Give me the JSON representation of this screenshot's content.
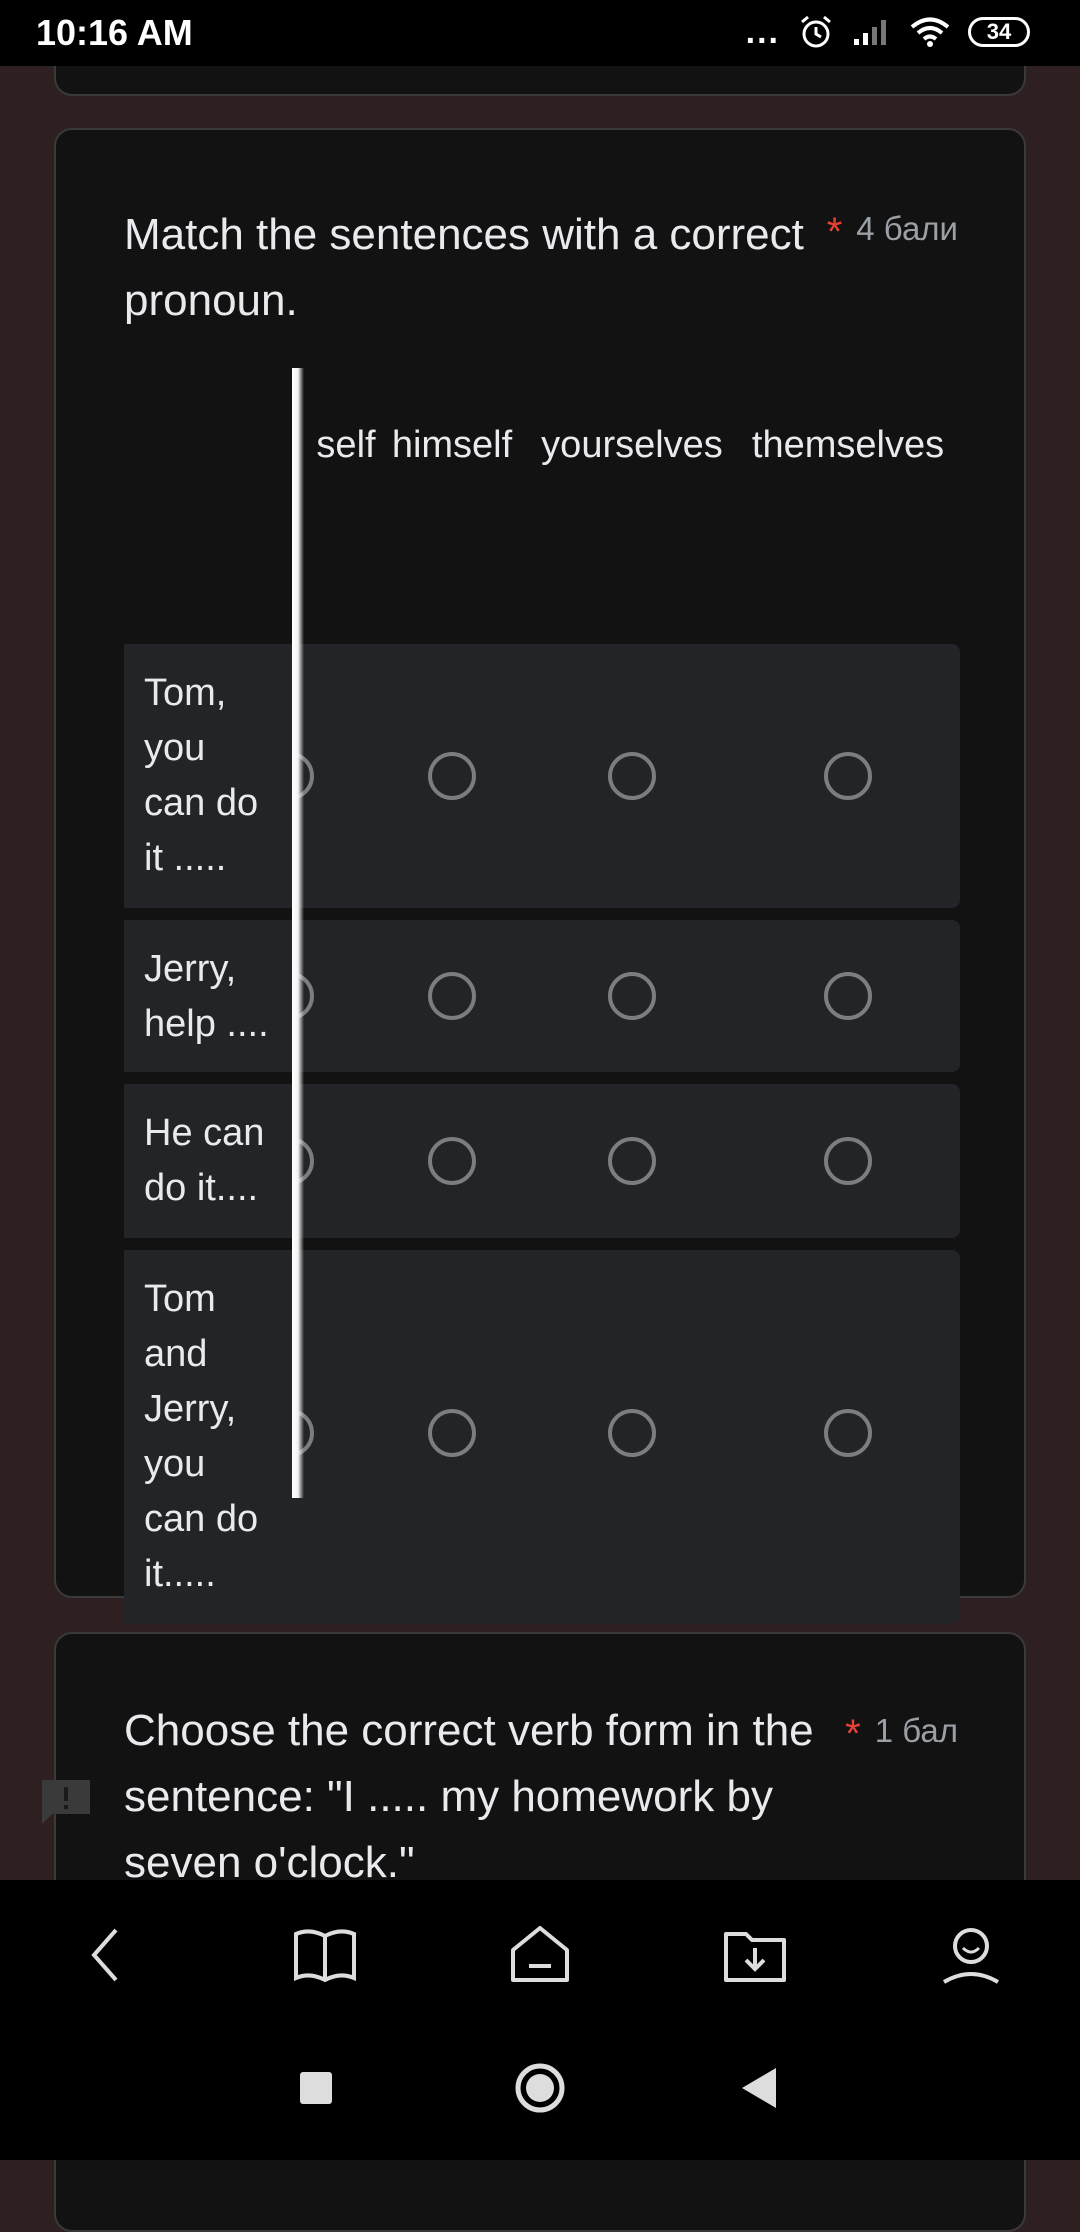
{
  "status_bar": {
    "time": "10:16 AM",
    "dots": "...",
    "battery": "34"
  },
  "question1": {
    "title": "Match the sentences with a correct pronoun.",
    "required_mark": "*",
    "points": "4 бали",
    "columns": [
      "self",
      "himself",
      "yourselves",
      "themselves"
    ],
    "rows": [
      {
        "label": "Tom, you can do it ....."
      },
      {
        "label": "Jerry, help ...."
      },
      {
        "label": "He can do it...."
      },
      {
        "label": "Tom and Jerry, you can do it....."
      }
    ]
  },
  "question2": {
    "title": "Choose the correct verb form in the sentence: \"I ..... my homework by seven o'clock.\"",
    "required_mark": "*",
    "points": "1 бал"
  },
  "browser_nav": {
    "icons": [
      "back-icon",
      "book-icon",
      "home-icon",
      "download-folder-icon",
      "profile-icon"
    ]
  },
  "system_nav": {
    "icons": [
      "recents-icon",
      "home-circle-icon",
      "back-triangle-icon"
    ]
  }
}
